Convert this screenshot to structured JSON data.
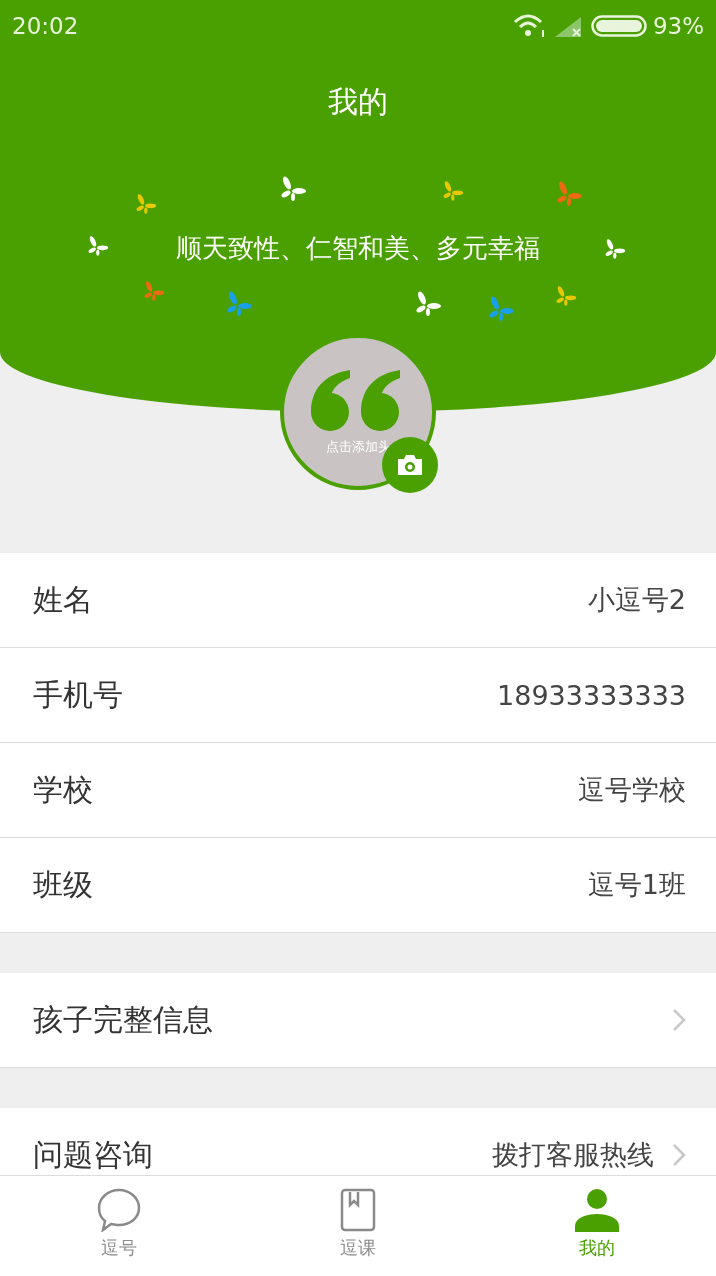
{
  "status_bar": {
    "time": "20:02",
    "battery": "93%"
  },
  "header": {
    "title": "我的",
    "slogan": "顺天致性、仁智和美、多元幸福"
  },
  "avatar": {
    "caption": "点击添加头"
  },
  "groups": [
    {
      "rows": [
        {
          "kind": "value",
          "label": "姓名",
          "value": "小逗号2"
        },
        {
          "kind": "value",
          "label": "手机号",
          "value": "18933333333"
        },
        {
          "kind": "value",
          "label": "学校",
          "value": "逗号学校"
        },
        {
          "kind": "value",
          "label": "班级",
          "value": "逗号1班"
        }
      ]
    },
    {
      "rows": [
        {
          "kind": "link",
          "label": "孩子完整信息"
        }
      ]
    },
    {
      "rows": [
        {
          "kind": "link",
          "label": "问题咨询",
          "value": "拨打客服热线"
        }
      ]
    }
  ],
  "tab_bar": [
    {
      "label": "逗号",
      "selected": false
    },
    {
      "label": "逗课",
      "selected": false
    },
    {
      "label": "我的",
      "selected": true
    }
  ]
}
